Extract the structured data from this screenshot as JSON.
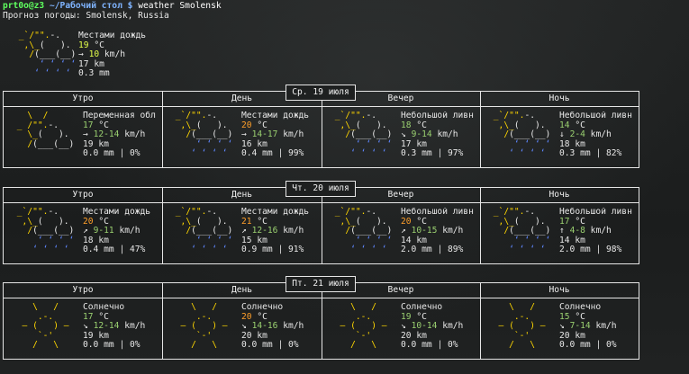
{
  "terminal": {
    "prompt_user": "prt0o@z3",
    "prompt_path": "~/Рабочий стол $",
    "command": "weather Smolensk",
    "location_line": "Прогноз погоды: Smolensk, Russia"
  },
  "current": {
    "condition": "Местами дождь",
    "temp": "19",
    "temp_unit": "°C",
    "wind_arrow": "→",
    "wind": "10",
    "wind_unit": "km/h",
    "visibility": "17 km",
    "precip": "0.3 mm",
    "icon": "patchy-rain-icon"
  },
  "periods": [
    "Утро",
    "День",
    "Вечер",
    "Ночь"
  ],
  "days": [
    {
      "label": "Ср. 19 июля",
      "forecasts": [
        {
          "icon": "partly-cloudy-icon",
          "condition": "Переменная обл",
          "temp": "17",
          "wind_arrow": "→",
          "wind": "12-14",
          "visibility": "19 km",
          "precip": "0.0 mm",
          "chance": "0%"
        },
        {
          "icon": "patchy-rain-icon",
          "condition": "Местами дождь",
          "temp": "20",
          "wind_arrow": "→",
          "wind": "14-17",
          "visibility": "16 km",
          "precip": "0.4 mm",
          "chance": "99%"
        },
        {
          "icon": "light-rain-icon",
          "condition": "Небольшой ливн",
          "temp": "18",
          "wind_arrow": "↘",
          "wind": "9-14",
          "visibility": "17 km",
          "precip": "0.3 mm",
          "chance": "97%"
        },
        {
          "icon": "light-rain-icon",
          "condition": "Небольшой ливн",
          "temp": "14",
          "wind_arrow": "↓",
          "wind": "2-4",
          "visibility": "18 km",
          "precip": "0.3 mm",
          "chance": "82%"
        }
      ]
    },
    {
      "label": "Чт. 20 июля",
      "forecasts": [
        {
          "icon": "patchy-rain-icon",
          "condition": "Местами дождь",
          "temp": "20",
          "wind_arrow": "↗",
          "wind": "9-11",
          "visibility": "18 km",
          "precip": "0.4 mm",
          "chance": "47%"
        },
        {
          "icon": "patchy-rain-icon",
          "condition": "Местами дождь",
          "temp": "21",
          "wind_arrow": "↗",
          "wind": "12-16",
          "visibility": "15 km",
          "precip": "0.9 mm",
          "chance": "91%"
        },
        {
          "icon": "light-rain-icon",
          "condition": "Небольшой ливн",
          "temp": "20",
          "wind_arrow": "↗",
          "wind": "10-15",
          "visibility": "14 km",
          "precip": "2.0 mm",
          "chance": "89%"
        },
        {
          "icon": "light-rain-icon",
          "condition": "Небольшой ливн",
          "temp": "17",
          "wind_arrow": "↑",
          "wind": "4-8",
          "visibility": "14 km",
          "precip": "2.0 mm",
          "chance": "98%"
        }
      ]
    },
    {
      "label": "Пт. 21 июля",
      "forecasts": [
        {
          "icon": "sunny-icon",
          "condition": "Солнечно",
          "temp": "17",
          "wind_arrow": "↘",
          "wind": "12-14",
          "visibility": "19 km",
          "precip": "0.0 mm",
          "chance": "0%"
        },
        {
          "icon": "sunny-icon",
          "condition": "Солнечно",
          "temp": "20",
          "wind_arrow": "↘",
          "wind": "14-16",
          "visibility": "20 km",
          "precip": "0.0 mm",
          "chance": "0%"
        },
        {
          "icon": "sunny-icon",
          "condition": "Солнечно",
          "temp": "19",
          "wind_arrow": "↘",
          "wind": "10-14",
          "visibility": "20 km",
          "precip": "0.0 mm",
          "chance": "0%"
        },
        {
          "icon": "sunny-icon",
          "condition": "Солнечно",
          "temp": "15",
          "wind_arrow": "↘",
          "wind": "7-14",
          "visibility": "20 km",
          "precip": "0.0 mm",
          "chance": "0%"
        }
      ]
    }
  ],
  "units": {
    "temp": "°C",
    "wind": "km/h",
    "separator": "|"
  },
  "colors": {
    "prompt_user": "#5fff5f",
    "prompt_path": "#7fb4ff",
    "sun": "#ffd700",
    "rain": "#5f87ff",
    "temp_green": "#9ad070",
    "temp_orange": "#ff9f2a"
  }
}
